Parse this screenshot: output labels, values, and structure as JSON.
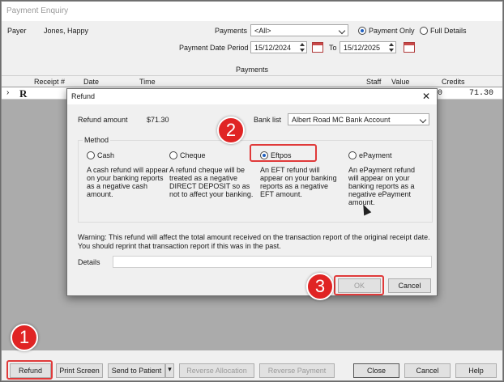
{
  "window": {
    "title": "Payment Enquiry"
  },
  "filters": {
    "payer_label": "Payer",
    "payer_value": "Jones, Happy",
    "payments_label": "Payments",
    "payments_value": "<All>",
    "payment_only_label": "Payment Only",
    "full_details_label": "Full Details",
    "period_label": "Payment Date Period",
    "date_from": "15/12/2024",
    "to_label": "To",
    "date_to": "15/12/2025"
  },
  "grid": {
    "band_title": "Payments",
    "columns": [
      "Receipt #",
      "Date",
      "Time",
      "Staff",
      "Value",
      "Credits"
    ],
    "row": {
      "marker": "R",
      "value_tail": "0",
      "credits": "71.30"
    }
  },
  "dialog": {
    "title": "Refund",
    "refund_amount_label": "Refund amount",
    "refund_amount_value": "$71.30",
    "bank_list_label": "Bank list",
    "bank_list_value": "Albert Road MC Bank Account",
    "method_label": "Method",
    "methods": [
      {
        "label": "Cash",
        "desc": "A cash refund will appear on your banking reports as a negative cash amount.",
        "selected": false
      },
      {
        "label": "Cheque",
        "desc": "A refund cheque will be treated as a negative DIRECT DEPOSIT so as not to affect your banking.",
        "selected": false
      },
      {
        "label": "Eftpos",
        "desc": "An EFT refund will appear on your banking reports as a negative EFT amount.",
        "selected": true
      },
      {
        "label": "ePayment",
        "desc": "An ePayment refund will appear on your banking reports as a negative ePayment amount.",
        "selected": false
      }
    ],
    "warning": "Warning: This refund will affect the total amount received on the transaction report of the original receipt date. You should reprint that transaction report if this was in the past.",
    "details_label": "Details",
    "ok_label": "OK",
    "cancel_label": "Cancel"
  },
  "toolbar": {
    "refund": "Refund",
    "print_screen": "Print Screen",
    "send_to_patient": "Send to Patient",
    "reverse_allocation": "Reverse Allocation",
    "reverse_payment": "Reverse Payment",
    "close": "Close",
    "cancel": "Cancel",
    "help": "Help"
  },
  "callouts": [
    "1",
    "2",
    "3"
  ],
  "colors": {
    "highlight": "#e03a3a",
    "badge": "#e02424",
    "accent": "#1f5fbf"
  }
}
